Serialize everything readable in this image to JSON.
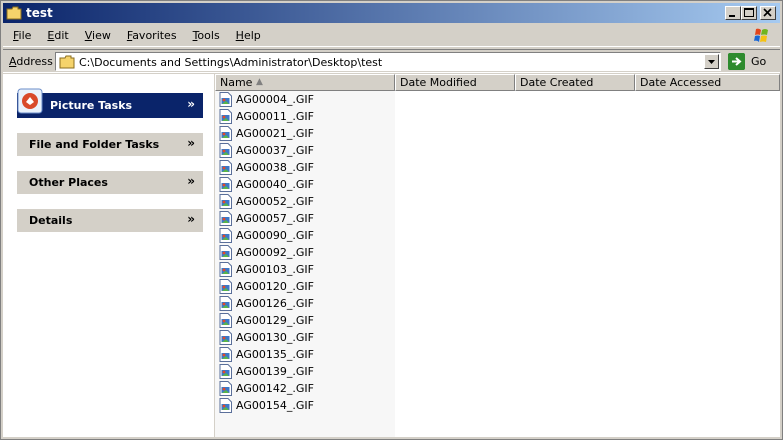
{
  "window": {
    "title": "test"
  },
  "menu": {
    "items": [
      "File",
      "Edit",
      "View",
      "Favorites",
      "Tools",
      "Help"
    ]
  },
  "address": {
    "label": "Address",
    "path": "C:\\Documents and Settings\\Administrator\\Desktop\\test",
    "go_label": "Go"
  },
  "taskpane": {
    "picture_tasks": "Picture Tasks",
    "file_folder_tasks": "File and Folder Tasks",
    "other_places": "Other Places",
    "details": "Details"
  },
  "columns": {
    "name": "Name",
    "date_modified": "Date Modified",
    "date_created": "Date Created",
    "date_accessed": "Date Accessed"
  },
  "files": [
    "AG00004_.GIF",
    "AG00011_.GIF",
    "AG00021_.GIF",
    "AG00037_.GIF",
    "AG00038_.GIF",
    "AG00040_.GIF",
    "AG00052_.GIF",
    "AG00057_.GIF",
    "AG00090_.GIF",
    "AG00092_.GIF",
    "AG00103_.GIF",
    "AG00120_.GIF",
    "AG00126_.GIF",
    "AG00129_.GIF",
    "AG00130_.GIF",
    "AG00135_.GIF",
    "AG00139_.GIF",
    "AG00142_.GIF",
    "AG00154_.GIF"
  ],
  "colors": {
    "title_start": "#0a246a",
    "title_end": "#a6caf0",
    "selected_header": "#0a246a"
  },
  "icons": {
    "folder": "folder-icon",
    "file": "gif-file-icon",
    "go": "go-arrow-icon"
  }
}
